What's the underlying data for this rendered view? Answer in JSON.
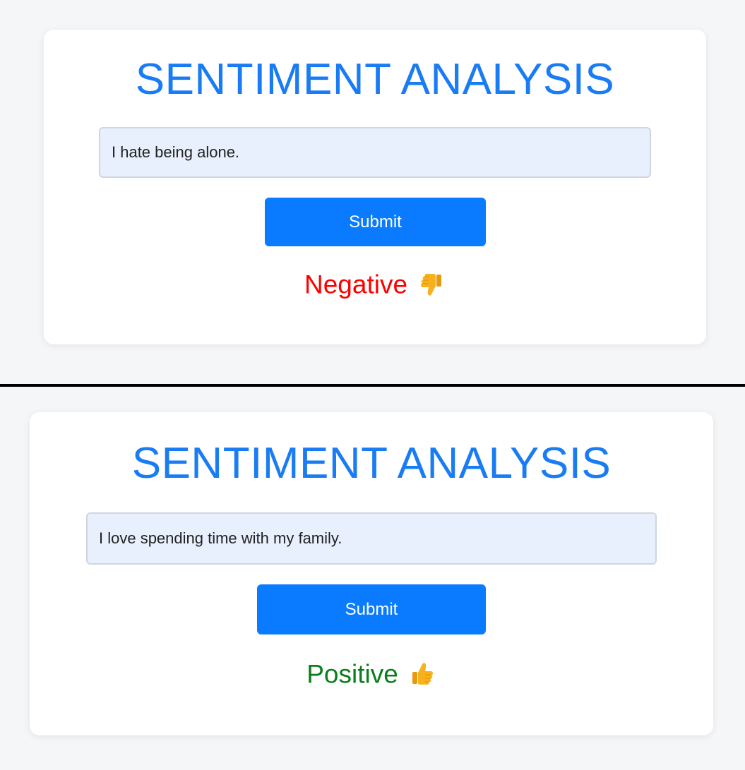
{
  "colors": {
    "accent": "#1a7cf4",
    "button": "#0a7bff",
    "negative": "#ff0000",
    "positive": "#0a7d1c",
    "icon": "#f7b11c"
  },
  "panels": [
    {
      "title": "SENTIMENT ANALYSIS",
      "input_value": "I hate being alone.",
      "submit_label": "Submit",
      "result_label": "Negative",
      "result_icon": "thumbs-down-icon"
    },
    {
      "title": "SENTIMENT ANALYSIS",
      "input_value": "I love spending time with my family.",
      "submit_label": "Submit",
      "result_label": "Positive",
      "result_icon": "thumbs-up-icon"
    }
  ]
}
